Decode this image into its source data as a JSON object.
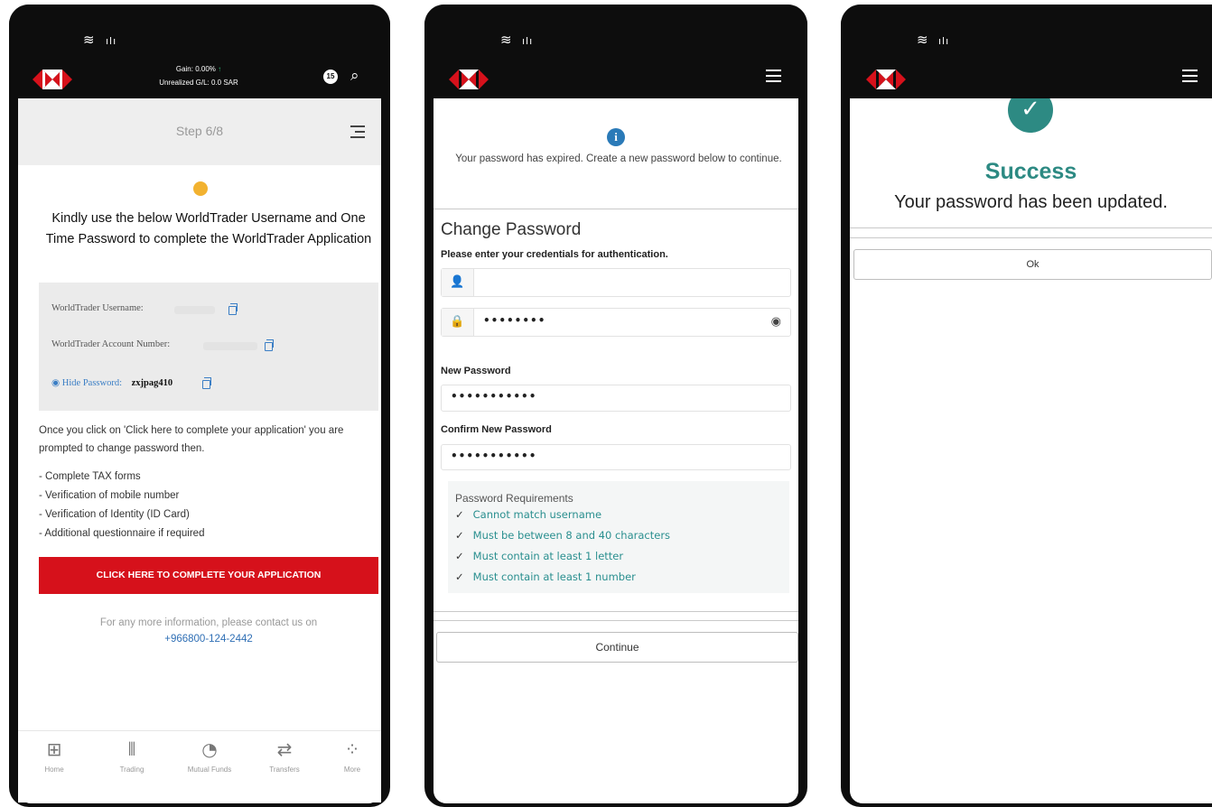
{
  "screen1": {
    "header": {
      "gain_line": "Gain: 0.00%",
      "unrealized_line": "Unrealized G/L: 0.0 SAR",
      "timer_badge": "15"
    },
    "step": "Step 6/8",
    "title": "Kindly use the below WorldTrader Username and One Time Password to complete the WorldTrader Application",
    "credentials": {
      "username_label": "WorldTrader Username:",
      "account_label": "WorldTrader Account Number:",
      "hide_password_label": "Hide Password:",
      "password_value": "zxjpag410"
    },
    "info_paragraph": "Once you click on 'Click here to complete your application' you are prompted to change password then.",
    "steps_list": [
      "- Complete TAX forms",
      "- Verification of mobile number",
      "- Verification of Identity (ID Card)",
      "- Additional questionnaire if required"
    ],
    "cta_label": "CLICK HERE TO COMPLETE YOUR APPLICATION",
    "contact_text": "For any more information, please contact us on",
    "contact_phone": "+966800-124-2442",
    "tabs": [
      {
        "label": "Home",
        "icon": "grid-icon"
      },
      {
        "label": "Trading",
        "icon": "candlestick-icon"
      },
      {
        "label": "Mutual Funds",
        "icon": "chart-circle-icon"
      },
      {
        "label": "Transfers",
        "icon": "transfer-icon"
      },
      {
        "label": "More",
        "icon": "more-icon"
      }
    ]
  },
  "screen2": {
    "expired_message": "Your password has expired. Create a new password below to continue.",
    "title": "Change Password",
    "subtitle": "Please enter your credentials for authentication.",
    "current_password_value": "••••••••",
    "new_password_label": "New Password",
    "new_password_value": "•••••••••••",
    "confirm_password_label": "Confirm New Password",
    "confirm_password_value": "•••••••••••",
    "requirements_title": "Password Requirements",
    "requirements": [
      "Cannot match username",
      "Must be between 8 and 40 characters",
      "Must contain at least 1 letter",
      "Must contain at least 1 number"
    ],
    "continue_label": "Continue"
  },
  "screen3": {
    "success_title": "Success",
    "success_message": "Your password has been updated.",
    "ok_label": "Ok"
  },
  "colors": {
    "brand_red": "#d6111b",
    "teal": "#2d8a83",
    "link_blue": "#2f6fb5"
  }
}
